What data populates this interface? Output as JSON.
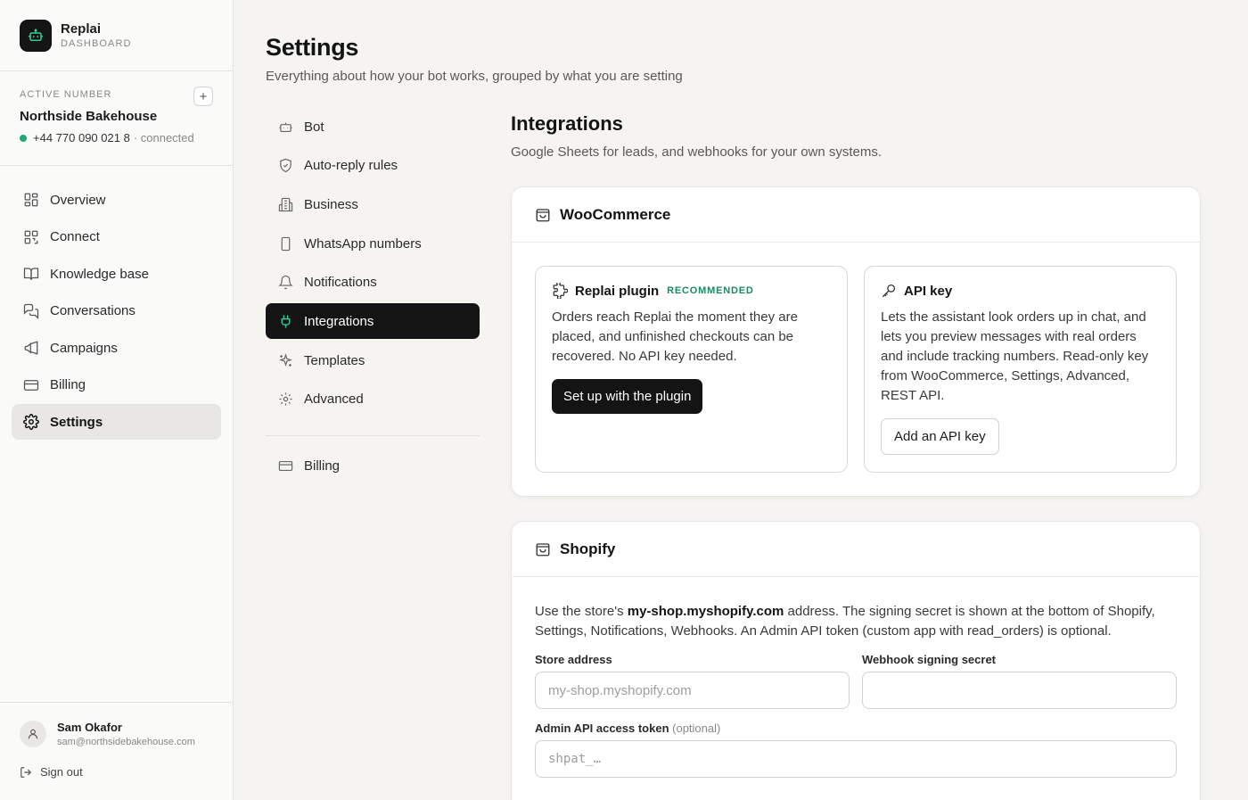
{
  "brand": {
    "name": "Replai",
    "sub": "DASHBOARD"
  },
  "active_number": {
    "label": "ACTIVE NUMBER",
    "add": "+",
    "name": "Northside Bakehouse",
    "phone": "+44 770 090 021 8",
    "status": "· connected"
  },
  "nav": {
    "items": [
      {
        "label": "Overview"
      },
      {
        "label": "Connect"
      },
      {
        "label": "Knowledge base"
      },
      {
        "label": "Conversations"
      },
      {
        "label": "Campaigns"
      },
      {
        "label": "Billing"
      },
      {
        "label": "Settings"
      }
    ]
  },
  "user": {
    "name": "Sam Okafor",
    "email": "sam@northsidebakehouse.com",
    "signout": "Sign out"
  },
  "page": {
    "title": "Settings",
    "subtitle": "Everything about how your bot works, grouped by what you are setting"
  },
  "subnav": {
    "items": [
      {
        "label": "Bot"
      },
      {
        "label": "Auto-reply rules"
      },
      {
        "label": "Business"
      },
      {
        "label": "WhatsApp numbers"
      },
      {
        "label": "Notifications"
      },
      {
        "label": "Integrations"
      },
      {
        "label": "Templates"
      },
      {
        "label": "Advanced"
      }
    ],
    "billing": "Billing"
  },
  "section": {
    "title": "Integrations",
    "subtitle": "Google Sheets for leads, and webhooks for your own systems."
  },
  "woocommerce": {
    "title": "WooCommerce",
    "plugin": {
      "title": "Replai plugin",
      "badge": "RECOMMENDED",
      "text": "Orders reach Replai the moment they are placed, and unfinished checkouts can be recovered. No API key needed.",
      "button": "Set up with the plugin"
    },
    "apikey": {
      "title": "API key",
      "text": "Lets the assistant look orders up in chat, and lets you preview messages with real orders and include tracking numbers. Read-only key from WooCommerce, Settings, Advanced, REST API.",
      "button": "Add an API key"
    }
  },
  "shopify": {
    "title": "Shopify",
    "desc_pre": "Use the store's ",
    "desc_bold": "my-shop.myshopify.com",
    "desc_post": " address. The signing secret is shown at the bottom of Shopify, Settings, Notifications, Webhooks. An Admin API token (custom app with read_orders) is optional.",
    "store_label": "Store address",
    "store_placeholder": "my-shop.myshopify.com",
    "secret_label": "Webhook signing secret",
    "secret_placeholder": "",
    "token_label": "Admin API access token",
    "token_optional": "(optional)",
    "token_placeholder": "shpat_…"
  },
  "colors": {
    "accent": "#141414",
    "status_green": "#1fa971",
    "badge_green": "#1a8a5c",
    "logo_icon": "#2ecc8f"
  }
}
